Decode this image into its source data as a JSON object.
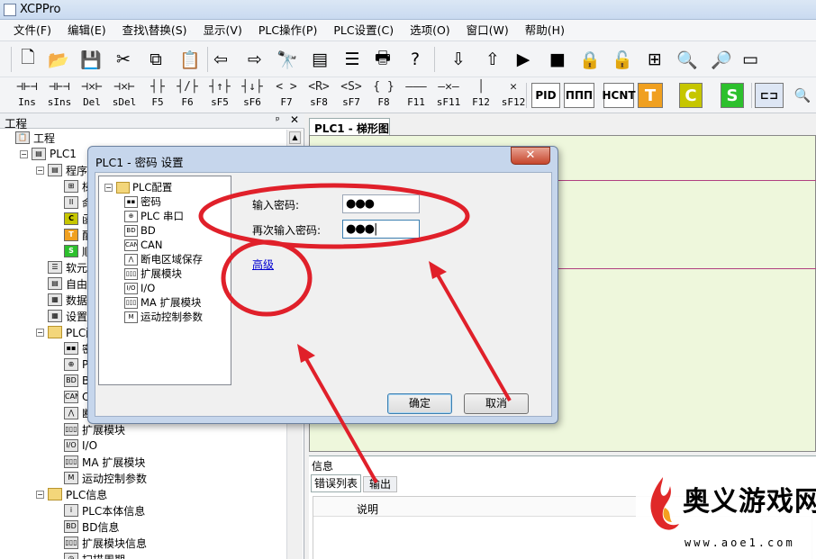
{
  "app": {
    "title": "XCPPro"
  },
  "menu": [
    "文件(F)",
    "编辑(E)",
    "查找\\替换(S)",
    "显示(V)",
    "PLC操作(P)",
    "PLC设置(C)",
    "选项(O)",
    "窗口(W)",
    "帮助(H)"
  ],
  "toolbar1": [
    {
      "name": "new-file-icon",
      "glyph": "🗋"
    },
    {
      "name": "open-folder-icon",
      "glyph": "📂"
    },
    {
      "name": "save-icon",
      "glyph": "💾"
    },
    {
      "name": "cut-icon",
      "glyph": "✂"
    },
    {
      "name": "copy-icon",
      "glyph": "⧉"
    },
    {
      "name": "paste-icon",
      "glyph": "📋"
    },
    {
      "name": "undo-arrow-icon",
      "glyph": "⇦"
    },
    {
      "name": "redo-arrow-icon",
      "glyph": "⇨"
    },
    {
      "name": "find-icon",
      "glyph": "🔭"
    },
    {
      "name": "ladder-view-icon",
      "glyph": "▤"
    },
    {
      "name": "instruction-list-icon",
      "glyph": "☰"
    },
    {
      "name": "print-icon",
      "glyph": "🖶"
    },
    {
      "name": "help-icon",
      "glyph": "?"
    },
    {
      "name": "download-icon",
      "glyph": "⇩"
    },
    {
      "name": "upload-icon",
      "glyph": "⇧"
    },
    {
      "name": "run-icon",
      "glyph": "▶"
    },
    {
      "name": "stop-icon",
      "glyph": "■"
    },
    {
      "name": "lock-icon",
      "glyph": "🔒"
    },
    {
      "name": "unlock-icon",
      "glyph": "🔓"
    },
    {
      "name": "monitor-icon",
      "glyph": "⊞"
    },
    {
      "name": "zoom-window-icon",
      "glyph": "🔍"
    },
    {
      "name": "zoom-doc-icon",
      "glyph": "🔎"
    },
    {
      "name": "serial-port-icon",
      "glyph": "▭"
    }
  ],
  "toolbar2": [
    {
      "name": "insert-line-icon",
      "glyph": "⊣⊢⊣",
      "label": "Ins"
    },
    {
      "name": "insert-column-icon",
      "glyph": "⊣⊢⊣",
      "label": "sIns"
    },
    {
      "name": "delete-line-icon",
      "glyph": "⊣✕⊢",
      "label": "Del"
    },
    {
      "name": "delete-column-icon",
      "glyph": "⊣✕⊢",
      "label": "sDel"
    },
    {
      "name": "no-contact-icon",
      "glyph": "┤├",
      "label": "F5"
    },
    {
      "name": "nc-contact-icon",
      "glyph": "┤/├",
      "label": "F6"
    },
    {
      "name": "rising-contact-icon",
      "glyph": "┤↑├",
      "label": "sF5"
    },
    {
      "name": "falling-contact-icon",
      "glyph": "┤↓├",
      "label": "sF6"
    },
    {
      "name": "coil-icon",
      "glyph": "<  >",
      "label": "F7"
    },
    {
      "name": "reset-coil-icon",
      "glyph": "<R>",
      "label": "sF8"
    },
    {
      "name": "set-coil-icon",
      "glyph": "<S>",
      "label": "sF7"
    },
    {
      "name": "instruction-icon",
      "glyph": "{  }",
      "label": "F8"
    },
    {
      "name": "hline-icon",
      "glyph": "———",
      "label": "F11"
    },
    {
      "name": "delete-hline-icon",
      "glyph": "—✕—",
      "label": "sF11"
    },
    {
      "name": "vline-icon",
      "glyph": "│",
      "label": "F12"
    },
    {
      "name": "delete-vline-icon",
      "glyph": "✕",
      "label": "sF12"
    }
  ],
  "toolbar2_big": [
    "PID",
    "ΠΠΠ",
    "HCNT",
    "T",
    "C",
    "S"
  ],
  "project": {
    "header": "工程",
    "pin": "ᵖ",
    "items": [
      {
        "label": "工程",
        "icon": "📋",
        "cls": "dev",
        "indent": 0,
        "ex": ""
      },
      {
        "label": "PLC1",
        "icon": "▤",
        "cls": "dev",
        "indent": 1,
        "ex": "−"
      },
      {
        "label": "程序",
        "icon": "▤",
        "cls": "dev",
        "indent": 2,
        "ex": "−"
      },
      {
        "label": "梯",
        "icon": "⊞",
        "cls": "dev",
        "indent": 3,
        "ex": ""
      },
      {
        "label": "命",
        "icon": "Il",
        "cls": "dev",
        "indent": 3,
        "ex": ""
      },
      {
        "label": "函",
        "icon": "C",
        "cls": "c",
        "indent": 3,
        "ex": ""
      },
      {
        "label": "配",
        "icon": "T",
        "cls": "t",
        "indent": 3,
        "ex": ""
      },
      {
        "label": "顺",
        "icon": "S",
        "cls": "s",
        "indent": 3,
        "ex": ""
      },
      {
        "label": "软元件",
        "icon": "☰",
        "cls": "dev",
        "indent": 2,
        "ex": ""
      },
      {
        "label": "自由监",
        "icon": "▤",
        "cls": "dev",
        "indent": 2,
        "ex": ""
      },
      {
        "label": "数据监",
        "icon": "▦",
        "cls": "dev",
        "indent": 2,
        "ex": ""
      },
      {
        "label": "设置软",
        "icon": "▦",
        "cls": "dev",
        "indent": 2,
        "ex": ""
      },
      {
        "label": "PLC配",
        "icon": "",
        "cls": "folder",
        "indent": 2,
        "ex": "−"
      },
      {
        "label": "密",
        "icon": "▪▪",
        "cls": "dev",
        "indent": 3,
        "ex": ""
      },
      {
        "label": "PLC",
        "icon": "⊕",
        "cls": "dev",
        "indent": 3,
        "ex": ""
      },
      {
        "label": "BD",
        "icon": "BD",
        "cls": "dev",
        "indent": 3,
        "ex": ""
      },
      {
        "label": "CA",
        "icon": "CAN",
        "cls": "dev",
        "indent": 3,
        "ex": ""
      },
      {
        "label": "断",
        "icon": "⋀",
        "cls": "dev",
        "indent": 3,
        "ex": ""
      },
      {
        "label": "扩展模块",
        "icon": "▯▯▯",
        "cls": "dev",
        "indent": 3,
        "ex": ""
      },
      {
        "label": "I/O",
        "icon": "I/O",
        "cls": "dev",
        "indent": 3,
        "ex": ""
      },
      {
        "label": "MA 扩展模块",
        "icon": "▯▯▯",
        "cls": "dev",
        "indent": 3,
        "ex": ""
      },
      {
        "label": "运动控制参数",
        "icon": "M",
        "cls": "dev",
        "indent": 3,
        "ex": ""
      },
      {
        "label": "PLC信息",
        "icon": "",
        "cls": "folder",
        "indent": 2,
        "ex": "−"
      },
      {
        "label": "PLC本体信息",
        "icon": "i",
        "cls": "dev",
        "indent": 3,
        "ex": ""
      },
      {
        "label": "BD信息",
        "icon": "BD",
        "cls": "dev",
        "indent": 3,
        "ex": ""
      },
      {
        "label": "扩展模块信息",
        "icon": "▯▯▯",
        "cls": "dev",
        "indent": 3,
        "ex": ""
      },
      {
        "label": "扫描周期",
        "icon": "◷",
        "cls": "dev",
        "indent": 3,
        "ex": ""
      }
    ]
  },
  "editor": {
    "tab": "PLC1 - 梯形图"
  },
  "info": {
    "label": "信息",
    "tabs": [
      "错误列表",
      "输出"
    ],
    "column": "说明"
  },
  "dialog": {
    "title": "PLC1 - 密码 设置",
    "close": "✕",
    "tree": [
      {
        "label": "PLC配置",
        "icon": "",
        "indent": 0,
        "folder": true
      },
      {
        "label": "密码",
        "icon": "▪▪",
        "indent": 1,
        "folder": false
      },
      {
        "label": "PLC 串口",
        "icon": "⊕",
        "indent": 1,
        "folder": false
      },
      {
        "label": "BD",
        "icon": "BD",
        "indent": 1,
        "folder": false
      },
      {
        "label": "CAN",
        "icon": "CAN",
        "indent": 1,
        "folder": false
      },
      {
        "label": "断电区域保存",
        "icon": "⋀",
        "indent": 1,
        "folder": false
      },
      {
        "label": "扩展模块",
        "icon": "▯▯▯",
        "indent": 1,
        "folder": false
      },
      {
        "label": "I/O",
        "icon": "I/O",
        "indent": 1,
        "folder": false
      },
      {
        "label": "MA 扩展模块",
        "icon": "▯▯▯",
        "indent": 1,
        "folder": false
      },
      {
        "label": "运动控制参数",
        "icon": "M",
        "indent": 1,
        "folder": false
      }
    ],
    "password_label": "输入密码:",
    "password_value": "●●●",
    "confirm_label": "再次输入密码:",
    "confirm_value": "●●●|",
    "advanced": "高级",
    "ok": "确定",
    "cancel": "取消"
  },
  "watermark": {
    "title": "奥义游戏网",
    "url": "www.aoe1.com"
  },
  "colors": {
    "annotation": "#e0202a",
    "ladder_bg": "#eef7dc",
    "dialog_frame": "#c6d6ec"
  }
}
